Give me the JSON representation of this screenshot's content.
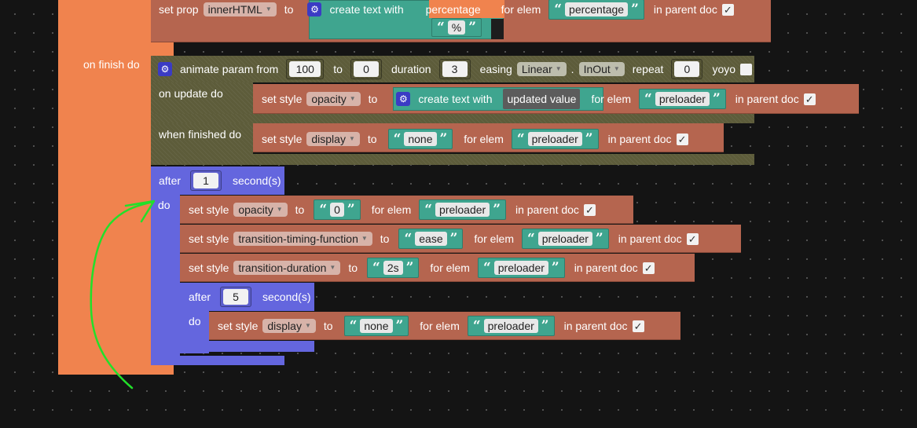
{
  "setprop": {
    "label": "set prop",
    "prop": "innerHTML",
    "to": "to",
    "create_text": "create text with",
    "var": "percentage",
    "str_pct": "%",
    "for_elem": "for elem",
    "elem": "percentage",
    "in_parent": "in parent doc"
  },
  "onfinish": {
    "label": "on finish do"
  },
  "animate": {
    "label": "animate param from",
    "from": "100",
    "to": "to",
    "to_val": "0",
    "duration": "duration",
    "duration_val": "3",
    "easing": "easing",
    "easing_val": "Linear",
    "dot": ".",
    "inout": "InOut",
    "repeat": "repeat",
    "repeat_val": "0",
    "yoyo": "yoyo",
    "on_update": "on update do",
    "when_finished": "when finished do"
  },
  "update_style": {
    "label": "set style",
    "prop": "opacity",
    "to": "to",
    "create_text": "create text with",
    "updated_value": "updated value",
    "for_elem": "for elem",
    "elem": "preloader",
    "in_parent": "in parent doc"
  },
  "finished_style": {
    "label": "set style",
    "prop": "display",
    "to": "to",
    "value": "none",
    "for_elem": "for elem",
    "elem": "preloader",
    "in_parent": "in parent doc"
  },
  "after1": {
    "after": "after",
    "num": "1",
    "seconds": "second(s)",
    "do": "do"
  },
  "s1": {
    "label": "set style",
    "prop": "opacity",
    "to": "to",
    "value": "0",
    "for_elem": "for elem",
    "elem": "preloader",
    "in_parent": "in parent doc"
  },
  "s2": {
    "label": "set style",
    "prop": "transition-timing-function",
    "to": "to",
    "value": "ease",
    "for_elem": "for elem",
    "elem": "preloader",
    "in_parent": "in parent doc"
  },
  "s3": {
    "label": "set style",
    "prop": "transition-duration",
    "to": "to",
    "value": "2s",
    "for_elem": "for elem",
    "elem": "preloader",
    "in_parent": "in parent doc"
  },
  "after5": {
    "after": "after",
    "num": "5",
    "seconds": "second(s)",
    "do": "do"
  },
  "s4": {
    "label": "set style",
    "prop": "display",
    "to": "to",
    "value": "none",
    "for_elem": "for elem",
    "elem": "preloader",
    "in_parent": "in parent doc"
  },
  "glyphs": {
    "open_quote": "“",
    "close_quote": "”",
    "check": "✓",
    "gear": "⚙",
    "dropdown_arrow": "▼"
  },
  "colors": {
    "control_orange": "#f0834e",
    "style_brown": "#b5654f",
    "timer_purple": "#6466de",
    "animate_olive": "#5d5c3a",
    "text_teal": "#3fa58f",
    "annotation_green": "#22e02a"
  }
}
